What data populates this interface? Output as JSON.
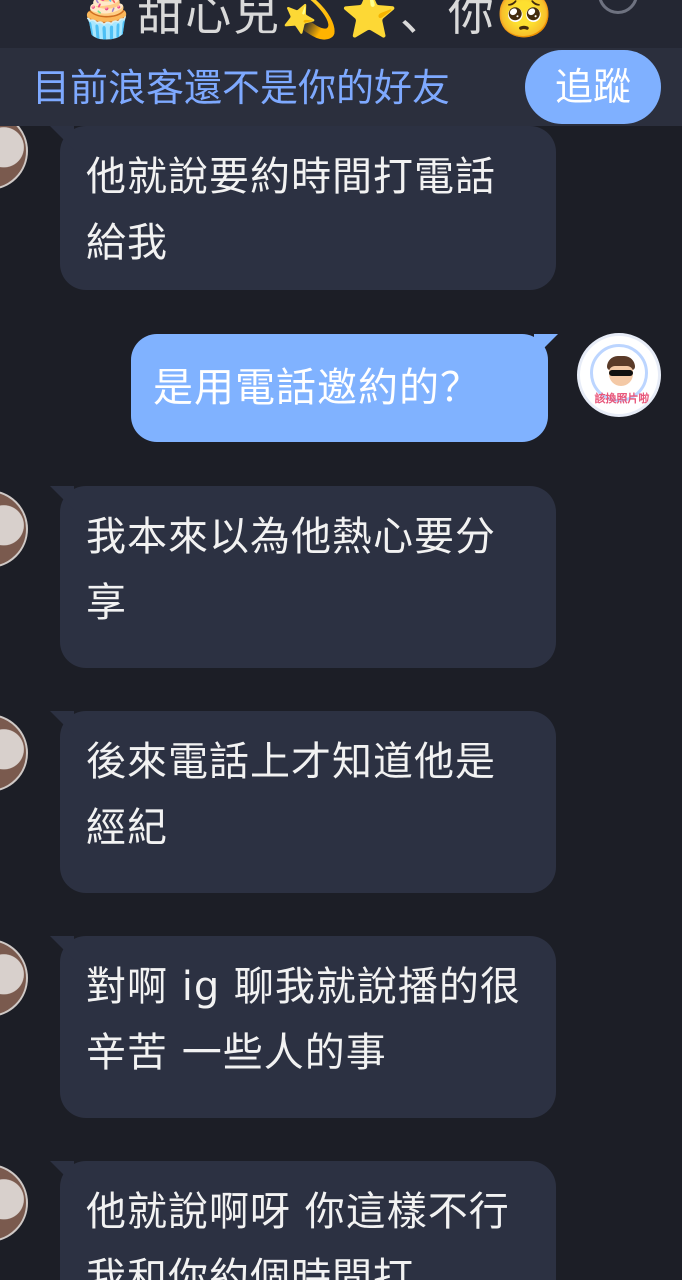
{
  "header": {
    "title": "🧁甜心兒💫⭐、你🥺"
  },
  "follow_banner": {
    "notice": "目前浪客還不是你的好友",
    "follow_label": "追蹤"
  },
  "messages": [
    {
      "direction": "in",
      "text": "他就說要約時間打電話給我"
    },
    {
      "direction": "out",
      "text": "是用電話邀約的？"
    },
    {
      "direction": "in",
      "text": "我本來以為他熱心要分享"
    },
    {
      "direction": "in",
      "text": "後來電話上才知道他是經紀"
    },
    {
      "direction": "in",
      "text": "對啊 ig 聊我就說播的很辛苦 一些人的事"
    },
    {
      "direction": "in",
      "text": "他就說啊呀 你這樣不行 我和你約個時間打"
    }
  ],
  "self_avatar": {
    "caption": "該換照片啦"
  },
  "colors": {
    "background": "#1c1e26",
    "incoming_bubble": "#2c3142",
    "outgoing_bubble": "#80b2ff",
    "accent": "#7ea9ff"
  }
}
